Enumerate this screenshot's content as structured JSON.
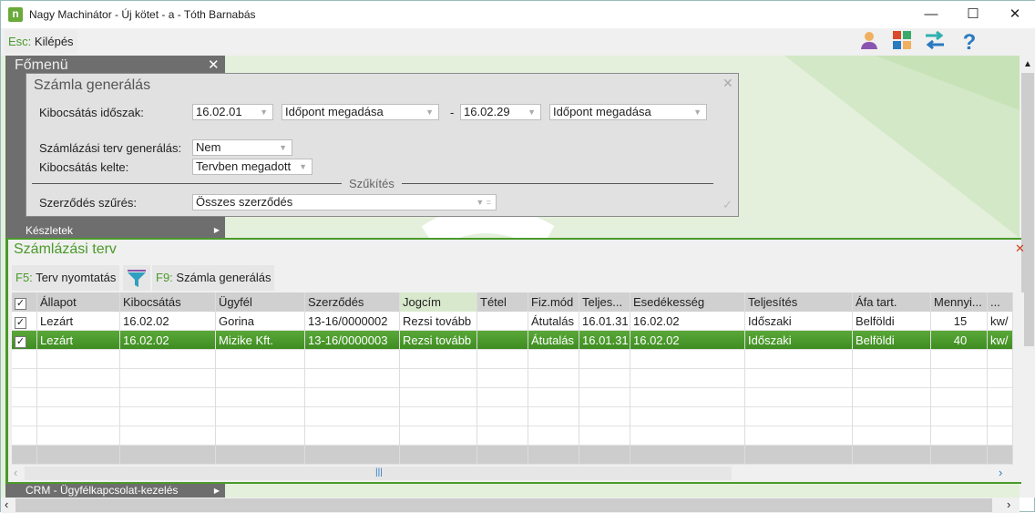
{
  "window": {
    "title": "Nagy Machinátor - Új kötet - a - Tóth Barnabás",
    "minimize": "—",
    "maximize": "☐",
    "close": "✕",
    "app_icon": "n"
  },
  "toolbar": {
    "esc_key": "Esc:",
    "esc_label": "Kilépés",
    "icons": [
      "user-icon",
      "tiles-icon",
      "swap-icon",
      "help-icon"
    ]
  },
  "fomenu": {
    "title": "Főmenü",
    "close": "✕",
    "items": [
      {
        "label": "Készletek"
      },
      {
        "label": "CRM - Ügyfélkapcsolat-kezelés"
      }
    ]
  },
  "dialog": {
    "title": "Számla generálás",
    "close": "✕",
    "period_label": "Kibocsátás időszak:",
    "from_date": "16.02.01",
    "from_mode": "Időpont megadása",
    "dash": "-",
    "to_date": "16.02.29",
    "to_mode": "Időpont megadása",
    "plan_label": "Számlázási terv generálás:",
    "plan_value": "Nem",
    "issue_label": "Kibocsátás kelte:",
    "issue_value": "Tervben megadott",
    "section": "Szűkítés",
    "filter_label": "Szerződés szűrés:",
    "filter_value": "Összes szerződés",
    "ok": "✓"
  },
  "panel": {
    "title": "Számlázási terv",
    "close": "✕",
    "f5_key": "F5:",
    "f5_label": "Terv nyomtatás",
    "f9_key": "F9:",
    "f9_label": "Számla generálás"
  },
  "grid": {
    "columns": [
      "✓",
      "Állapot",
      "Kibocsátás",
      "Ügyfél",
      "Szerződés",
      "Jogcím",
      "Tétel",
      "Fiz.mód",
      "Teljes...",
      "Esedékesség",
      "Teljesítés",
      "Áfa tart.",
      "Mennyi...",
      "..."
    ],
    "rows": [
      [
        "✓",
        "Lezárt",
        "16.02.02",
        "Gorina",
        "13-16/0000002",
        "Rezsi tovább",
        "",
        "Átutalás",
        "16.01.31",
        "16.02.02",
        "Időszaki",
        "Belföldi",
        "15",
        "kw/"
      ],
      [
        "✓",
        "Lezárt",
        "16.02.02",
        "Mizike Kft.",
        "13-16/0000003",
        "Rezsi tovább",
        "",
        "Átutalás",
        "16.01.31",
        "16.02.02",
        "Időszaki",
        "Belföldi",
        "40",
        "kw/"
      ]
    ],
    "selected_row": 1,
    "scroll_grip": "|||"
  },
  "colors": {
    "accent": "#4a9a2a",
    "selected": "#4a9a2a",
    "menu": "#6e6e6e"
  }
}
